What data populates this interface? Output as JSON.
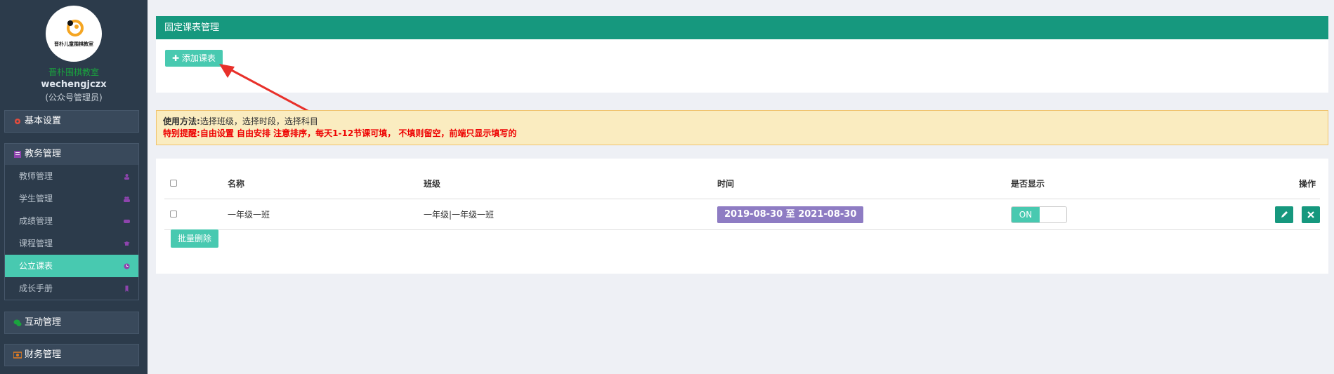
{
  "sidebar": {
    "logo_text": "晋朴儿童围棋教室",
    "school_name": "晋朴围棋教室",
    "username": "wechengjczx",
    "role": "(公众号管理员)",
    "groups": {
      "basic": {
        "label": "基本设置",
        "icon": "gear-icon",
        "color": "#e74c3c"
      },
      "academic": {
        "label": "教务管理",
        "icon": "list-icon",
        "color": "#8e44ad",
        "items": [
          {
            "label": "教师管理",
            "icon": "user-icon"
          },
          {
            "label": "学生管理",
            "icon": "users-icon"
          },
          {
            "label": "成绩管理",
            "icon": "gamepad-icon"
          },
          {
            "label": "课程管理",
            "icon": "graduation-cap-icon"
          },
          {
            "label": "公立课表",
            "icon": "clock-icon",
            "active": true
          },
          {
            "label": "成长手册",
            "icon": "bookmark-icon"
          }
        ]
      },
      "interaction": {
        "label": "互动管理",
        "icon": "wechat-icon",
        "color": "#1aa33e"
      },
      "finance": {
        "label": "财务管理",
        "icon": "money-icon",
        "color": "#e67e22"
      }
    }
  },
  "panel": {
    "title": "固定课表管理",
    "add_button": "添加课表"
  },
  "notice": {
    "usage_label": "使用方法:",
    "usage_text": "选择班级，选择时段，选择科目",
    "tip_label": "特别提醒:",
    "tip_text": "自由设置 自由安排 注意排序，每天1-12节课可填， 不填则留空，前端只显示填写的"
  },
  "table": {
    "headers": {
      "name": "名称",
      "class": "班级",
      "time": "时间",
      "display": "是否显示",
      "actions": "操作"
    },
    "rows": [
      {
        "name": "一年级一班",
        "class": "一年级|一年级一班",
        "time": "2019-08-30 至 2021-08-30",
        "display": "ON"
      }
    ],
    "batch_delete": "批量删除"
  },
  "colors": {
    "sidebar_bg": "#2c3b4b",
    "accent_dark": "#16987e",
    "accent_light": "#48c9b0",
    "date_badge": "#8e7cc3",
    "warning_bg": "#faecc0",
    "warning_text": "#ee0000"
  }
}
